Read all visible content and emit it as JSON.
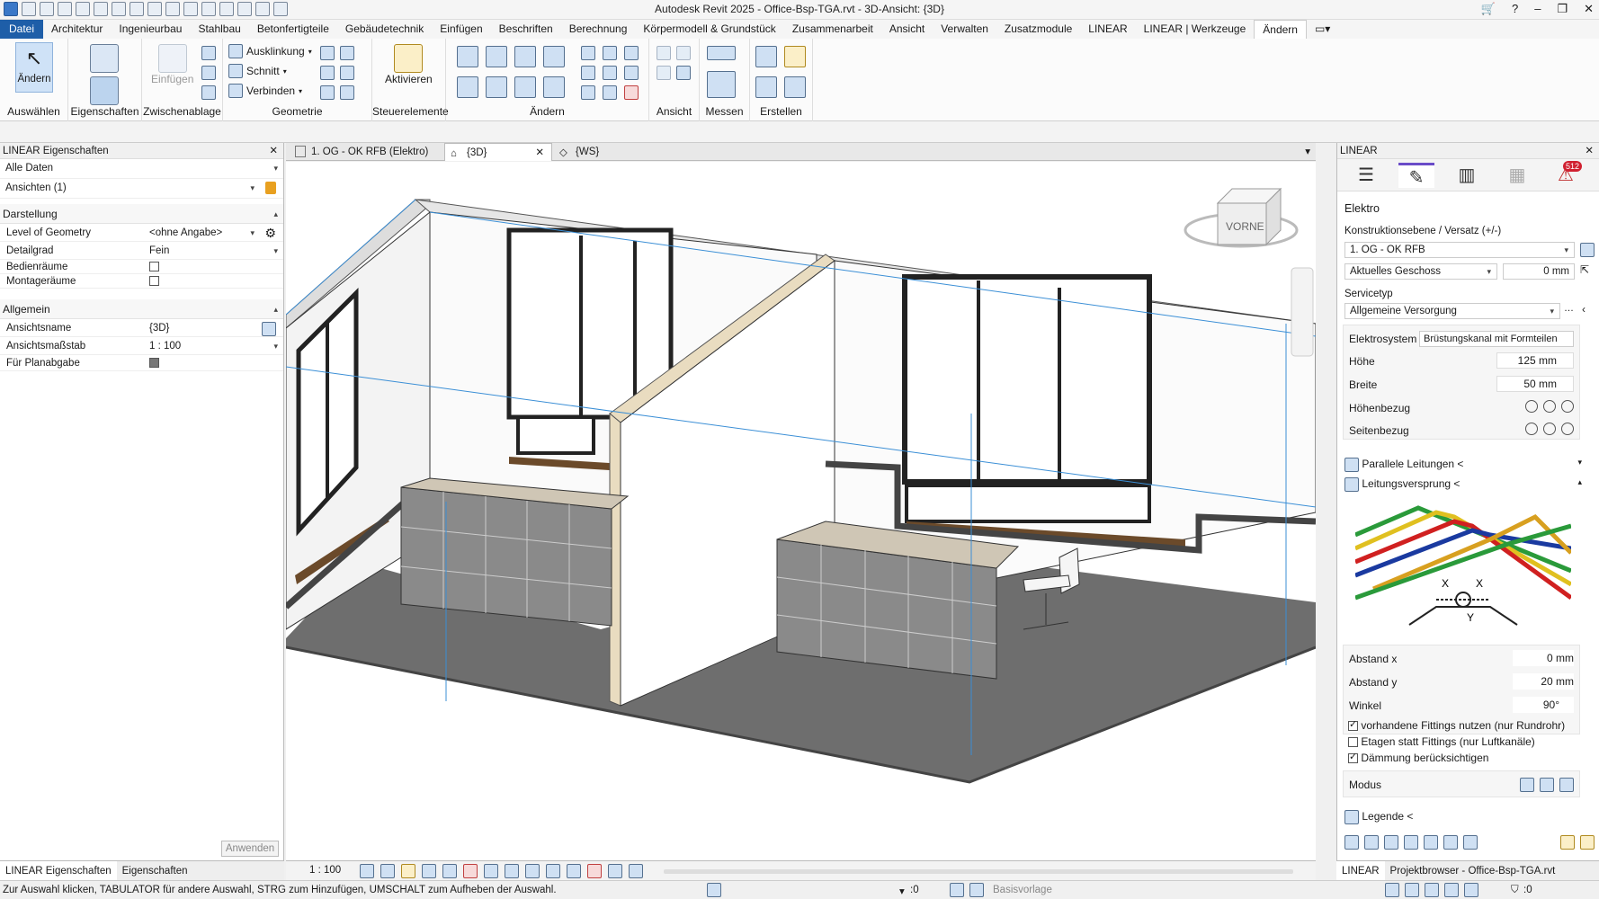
{
  "window": {
    "title": "Autodesk Revit 2025 - Office-Bsp-TGA.rvt - 3D-Ansicht: {3D}"
  },
  "menu": [
    "Datei",
    "Architektur",
    "Ingenieurbau",
    "Stahlbau",
    "Betonfertigteile",
    "Gebäudetechnik",
    "Einfügen",
    "Beschriften",
    "Berechnung",
    "Körpermodell & Grundstück",
    "Zusammenarbeit",
    "Ansicht",
    "Verwalten",
    "Zusatzmodule",
    "LINEAR",
    "LINEAR | Werkzeuge",
    "Ändern"
  ],
  "ribbon": {
    "modify_label": "Ändern",
    "select_group": "Auswählen",
    "props_group": "Eigenschaften",
    "clipboard_group": "Zwischenablage",
    "paste_label": "Einfügen",
    "geometry_group": "Geometrie",
    "cope_label": "Ausklinkung",
    "cut_label": "Schnitt",
    "join_label": "Verbinden",
    "controls_group": "Steuerelemente",
    "activate_label": "Aktivieren",
    "modify_group": "Ändern",
    "view_group": "Ansicht",
    "measure_group": "Messen",
    "create_group": "Erstellen"
  },
  "left_panel": {
    "title": "LINEAR Eigenschaften",
    "filter": "Alle Daten",
    "selection": "Ansichten (1)",
    "section_display": "Darstellung",
    "rows_display": [
      {
        "key": "Level of Geometry",
        "value": "<ohne Angabe>"
      },
      {
        "key": "Detailgrad",
        "value": "Fein"
      },
      {
        "key": "Bedienräume",
        "value": ""
      },
      {
        "key": "Montageräume",
        "value": ""
      }
    ],
    "section_general": "Allgemein",
    "rows_general": [
      {
        "key": "Ansichtsname",
        "value": "{3D}"
      },
      {
        "key": "Ansichtsmaßstab",
        "value": "1 : 100"
      },
      {
        "key": "Für Planabgabe",
        "value": ""
      }
    ],
    "apply": "Anwenden",
    "tabs": [
      "LINEAR Eigenschaften",
      "Eigenschaften"
    ]
  },
  "view_tabs": [
    "1. OG - OK RFB (Elektro)",
    "{3D}",
    "{WS}"
  ],
  "viewcube_label": "VORNE",
  "view_bar": {
    "scale": "1 : 100"
  },
  "status": {
    "hint": "Zur Auswahl klicken, TABULATOR für andere Auswahl, STRG zum Hinzufügen, UMSCHALT zum Aufheben der Auswahl.",
    "zero": ":0",
    "template": "Basisvorlage",
    "filter_count": ":0"
  },
  "right_panel": {
    "title": "LINEAR",
    "badge": "512",
    "discipline": "Elektro",
    "level_label": "Konstruktionsebene / Versatz (+/-)",
    "level_value": "1. OG - OK RFB",
    "current_floor": "Aktuelles Geschoss",
    "offset": "0 mm",
    "service_label": "Servicetyp",
    "service_value": "Allgemeine Versorgung",
    "system_label": "Elektrosystem",
    "system_value": "Brüstungskanal mit Formteilen",
    "height_label": "Höhe",
    "height_value": "125 mm",
    "width_label": "Breite",
    "width_value": "50 mm",
    "hbezug_label": "Höhenbezug",
    "sbezug_label": "Seitenbezug",
    "parallel_label": "Parallele Leitungen <",
    "jump_label": "Leitungsversprung <",
    "abstand_x_label": "Abstand x",
    "abstand_x": "0 mm",
    "abstand_y_label": "Abstand y",
    "abstand_y": "20 mm",
    "winkel_label": "Winkel",
    "winkel": "90°",
    "opt1": "vorhandene Fittings nutzen (nur Rundrohr)",
    "opt2": "Etagen statt Fittings (nur Luftkanäle)",
    "opt3": "Dämmung berücksichtigen",
    "modus_label": "Modus",
    "legend_label": "Legende <",
    "diagram_x": "X",
    "diagram_y": "Y",
    "tabs": [
      "LINEAR",
      "Projektbrowser - Office-Bsp-TGA.rvt"
    ]
  }
}
